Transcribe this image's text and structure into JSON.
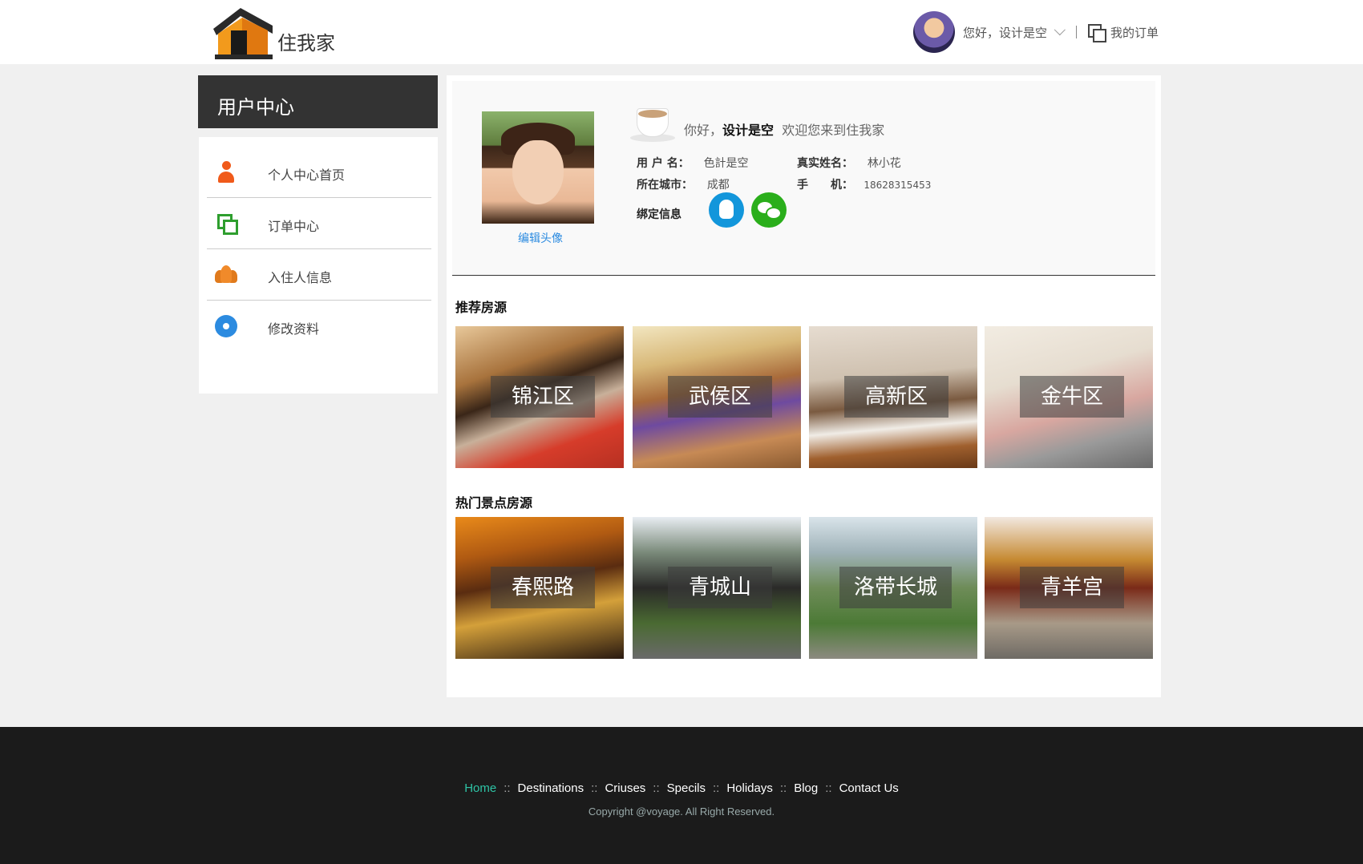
{
  "header": {
    "logo_text": "住我家",
    "greeting": "您好，设计是空",
    "orders_link": "我的订单"
  },
  "sidebar": {
    "title": "用户中心",
    "items": [
      {
        "label": "个人中心首页",
        "icon": "person-icon"
      },
      {
        "label": "订单中心",
        "icon": "orders-icon"
      },
      {
        "label": "入住人信息",
        "icon": "guests-icon"
      },
      {
        "label": "修改资料",
        "icon": "settings-icon"
      }
    ]
  },
  "profile": {
    "edit_avatar": "编辑头像",
    "welcome_prefix": "你好，",
    "username_bold": "设计是空",
    "welcome_suffix": "欢迎您来到住我家",
    "fields": {
      "username_key": "用 户 名：",
      "username_val": "色計是空",
      "realname_key": "真实姓名：",
      "realname_val": "林小花",
      "city_key": "所在城市：",
      "city_val": "成都",
      "phone_key": "手　　机：",
      "phone_val": "18628315453"
    },
    "bind_label": "绑定信息"
  },
  "recommended": {
    "title": "推荐房源",
    "tiles": [
      "锦江区",
      "武侯区",
      "高新区",
      "金牛区"
    ]
  },
  "hot_spots": {
    "title": "热门景点房源",
    "tiles": [
      "春熙路",
      "青城山",
      "洛带长城",
      "青羊宫"
    ]
  },
  "footer": {
    "nav": [
      "Home",
      "Destinations",
      "Criuses",
      "Specils",
      "Holidays",
      "Blog",
      "Contact Us"
    ],
    "copyright": "Copyright @voyage. All Right Reserved."
  },
  "colors": {
    "accent_blue": "#2c8be0",
    "footer_active": "#2ec4a6",
    "sidebar_head": "#333333"
  }
}
